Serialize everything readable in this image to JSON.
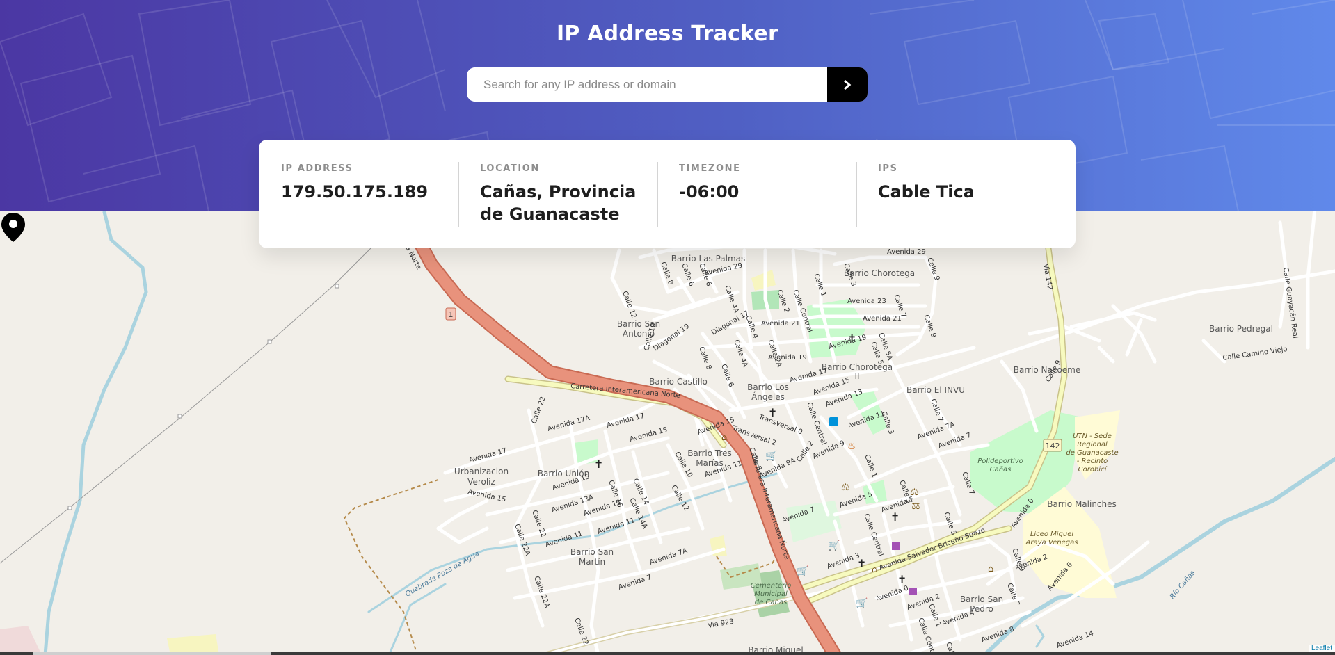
{
  "header": {
    "title": "IP Address Tracker",
    "search_placeholder": "Search for any IP address or domain",
    "search_value": ""
  },
  "info": [
    {
      "label": "IP ADDRESS",
      "value": "179.50.175.189"
    },
    {
      "label": "LOCATION",
      "value": "Cañas, Provincia de Guanacaste"
    },
    {
      "label": "TIMEZONE",
      "value": "-06:00"
    },
    {
      "label": "IPS",
      "value": "Cable Tica"
    }
  ],
  "map": {
    "attribution": "Leaflet",
    "road_badges": [
      "1",
      "142"
    ],
    "labels": {
      "carretera": "Carretera Interamericana Norte",
      "carretera_b": "Carretera Interamericana Norte",
      "carretera_c": "na Norte",
      "via142": "Via 142",
      "via923": "Via 923",
      "barrio_las_palmas": "Barrio Las Palmas",
      "barrio_chorotega": "Barrio Chorotega",
      "barrio_chorotega_ii": "Barrio Chorotega II",
      "barrio_san_antonio": "Barrio San Antonio",
      "barrio_castillo": "Barrio Castillo",
      "barrio_los_angeles": "Barrio Los Ángeles",
      "barrio_el_invu": "Barrio El INVU",
      "barrio_nacoeme": "Barrio Nacoeme",
      "barrio_pedregal": "Barrio Pedregal",
      "barrio_tres_marias": "Barrio Tres Marías",
      "barrio_union": "Barrio Unión",
      "urbanizacion_veroliz": "Urbanizacion Veroliz",
      "barrio_san_martin": "Barrio San Martín",
      "barrio_malinches": "Barrio Malinches",
      "barrio_san_pedro": "Barrio San Pedro",
      "barrio_miguel": "Barrio Miguel",
      "polideportivo": "Polideportivo Cañas",
      "utn": "UTN - Sede Regional de Guanacaste - Recinto Corobicí",
      "liceo": "Liceo Miguel Araya Venegas",
      "cementerio": "Cementerio Municipal de Cañas",
      "quebrada": "Quebrada Poza de Agua",
      "rio_canas": "Río Cañas",
      "calle_camino_viejo": "Calle Camino Viejo",
      "calle_guayacan": "Calle Guayacán Real",
      "avenida_salvador": "Avenida Salvador Briceño Suazo",
      "avenida_0": "Avenida 0",
      "avenida_0b": "Avenida 0",
      "avenida_29": "Avenida 29",
      "avenida_23": "Avenida 23",
      "avenida_21": "Avenida 21",
      "avenida_19": "Avenida 19",
      "avenida_17": "Avenida 17",
      "avenida_17a": "Avenida 17A",
      "avenida_15": "Avenida 15",
      "avenida_13": "Avenida 13",
      "avenida_13a": "Avenida 13A",
      "avenida_11": "Avenida 11",
      "avenida_9": "Avenida 9",
      "avenida_9a": "Avenida 9A",
      "avenida_7": "Avenida 7",
      "avenida_7a": "Avenida 7A",
      "avenida_5": "Avenida 5",
      "avenida_3": "Avenida 3",
      "avenida_2": "Avenida 2",
      "avenida_4": "Avenida 4",
      "avenida_6": "Avenida 6",
      "avenida_8": "Avenida 8",
      "avenida_14": "Avenida 14",
      "transversal_2": "Transversal 2",
      "transversal_0": "Transversal 0",
      "diagonal_17": "Diagonal 17",
      "diagonal_19": "Diagonal 19",
      "calle_central": "Calle Central",
      "calle_22": "Calle 22",
      "calle_22a": "Calle 22A",
      "calle_16": "Calle 16",
      "calle_14": "Calle 14",
      "calle_14a": "Calle 14A",
      "calle_12": "Calle 12",
      "calle_10": "Calle 10",
      "calle_8": "Calle 8",
      "calle_6": "Calle 6",
      "calle_4": "Calle 4",
      "calle_4a": "Calle 4A",
      "calle_2": "Calle 2",
      "calle_2a": "Calle 2A",
      "calle_1": "Calle 1",
      "calle_3": "Calle 3",
      "calle_5": "Calle 5",
      "calle_5a": "Calle 5A",
      "calle_7": "Calle 7",
      "calle_9": "Calle 9"
    }
  },
  "colors": {
    "header_start": "#4b37a3",
    "header_end": "#6089ea",
    "highway": "#e8927c",
    "primary_road": "#f7fabf",
    "park": "#c8facc",
    "water": "#aad3df"
  }
}
